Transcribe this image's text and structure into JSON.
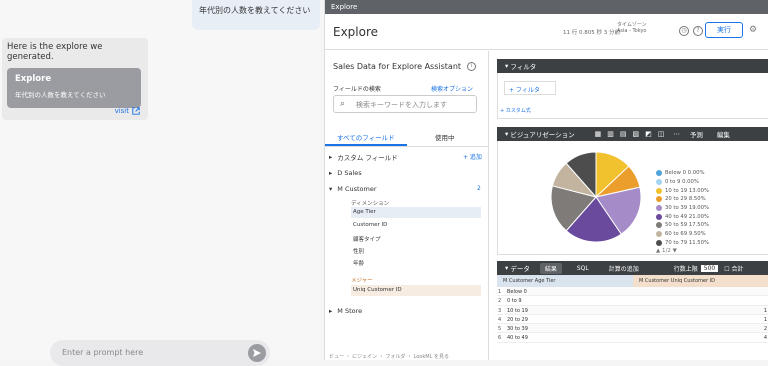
{
  "chat": {
    "user_message": "年代別の人数を教えてください",
    "bot_message": "Here is the explore we generated.",
    "card_title": "Explore",
    "card_subtitle": "年代別の人数を教えてください",
    "visit_label": "visit",
    "prompt_placeholder": "Enter a prompt here"
  },
  "looker": {
    "topbar": "Explore",
    "header": {
      "title": "Explore",
      "meta": "11 行  0.805 秒  3 分前",
      "tz_label": "タイムゾーン",
      "tz_value": "Asia - Tokyo",
      "run_label": "実行"
    },
    "sidebar": {
      "title": "Sales Data for Explore Assistant",
      "search_label": "フィールドの検索",
      "search_options": "検索オプション",
      "search_placeholder": "検索キーワードを入力します",
      "tab_all": "すべてのフィールド",
      "tab_used": "使用中",
      "custom_fields": "カスタム フィールド",
      "add": "+ 追加",
      "view_sales": "D Sales",
      "view_customer": "M Customer",
      "customer_count": "2",
      "dimension_header": "ディメンション",
      "dimensions": [
        "Age Tier",
        "Customer ID",
        "顧客タイプ",
        "性別",
        "年齢"
      ],
      "measure_header": "メジャー",
      "measures": [
        "Uniq Customer ID"
      ],
      "view_store": "M Store",
      "footer": "ビュー  ・  にジェイン  ・  フォルダ  ・  LookML を見る"
    },
    "filters": {
      "label": "フィルタ",
      "add_filter": "+ フィルタ",
      "custom_filter": "+ カスタム式"
    },
    "viz": {
      "label": "ビジュアリゼーション",
      "edit_label": "編集",
      "settings_label": "予測",
      "legend": [
        {
          "label": "Below 0 0.00%",
          "color": "#4ea3d8"
        },
        {
          "label": "0 to 9 0.00%",
          "color": "#a3d4f0"
        },
        {
          "label": "10 to 19 13.00%",
          "color": "#f2c12e"
        },
        {
          "label": "20 to 29 8.50%",
          "color": "#ec9e2d"
        },
        {
          "label": "30 to 39 19.00%",
          "color": "#a58cc9"
        },
        {
          "label": "40 to 49 21.00%",
          "color": "#6a4a9c"
        },
        {
          "label": "50 to 59 17.50%",
          "color": "#7e7b78"
        },
        {
          "label": "60 to 69 9.50%",
          "color": "#c2b49e"
        },
        {
          "label": "70 to 79 11.50%",
          "color": "#4d4d4d"
        }
      ],
      "page": "1/2"
    },
    "data": {
      "label": "データ",
      "tab_results": "結果",
      "tab_sql": "SQL",
      "tab_calc": "計算の追加",
      "row_limit_label": "行数上限",
      "row_limit": "500",
      "totals_label": "合計",
      "col1": "M Customer Age Tier",
      "col2": "M Customer Uniq Customer ID",
      "rows": [
        {
          "n": "1",
          "a": "Below 0",
          "b": ""
        },
        {
          "n": "2",
          "a": "0 to 9",
          "b": ""
        },
        {
          "n": "3",
          "a": "10 to 19",
          "b": "1"
        },
        {
          "n": "4",
          "a": "20 to 29",
          "b": "1"
        },
        {
          "n": "5",
          "a": "30 to 39",
          "b": "2"
        },
        {
          "n": "6",
          "a": "40 to 49",
          "b": "4"
        }
      ]
    }
  },
  "chart_data": {
    "type": "pie",
    "categories": [
      "Below 0",
      "0 to 9",
      "10 to 19",
      "20 to 29",
      "30 to 39",
      "40 to 49",
      "50 to 59",
      "60 to 69",
      "70 to 79"
    ],
    "values": [
      0.0,
      0.0,
      13.0,
      8.5,
      19.0,
      21.0,
      17.5,
      9.5,
      11.5
    ],
    "colors": [
      "#4ea3d8",
      "#a3d4f0",
      "#f2c12e",
      "#ec9e2d",
      "#a58cc9",
      "#6a4a9c",
      "#7e7b78",
      "#c2b49e",
      "#4d4d4d"
    ],
    "legend": "right"
  }
}
